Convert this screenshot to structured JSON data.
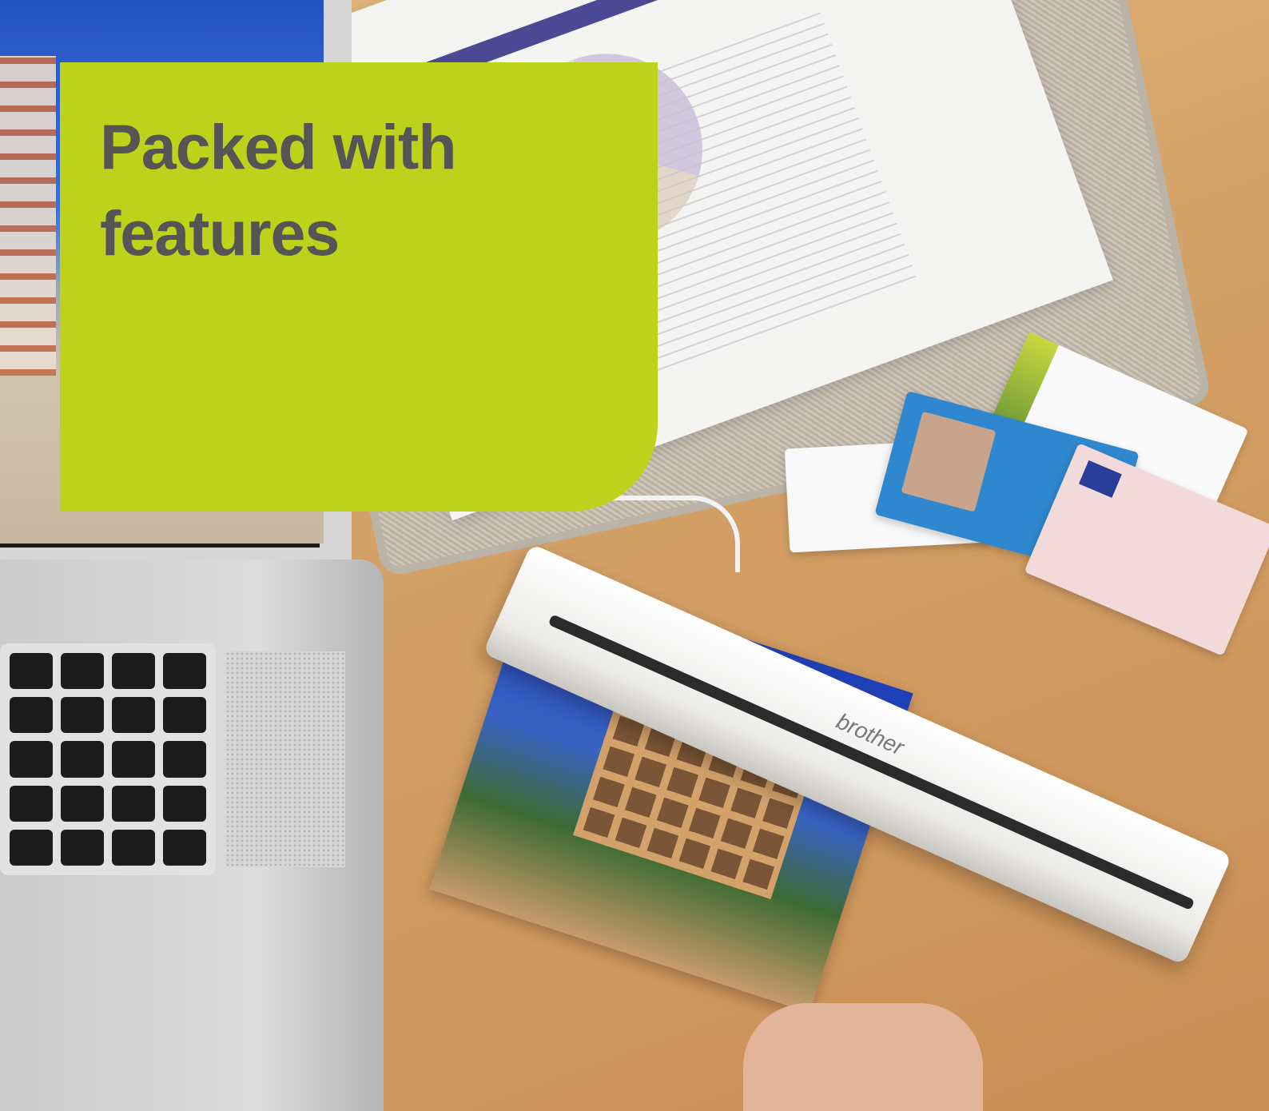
{
  "headline": {
    "line1": "Packed with",
    "line2": "features"
  },
  "colors": {
    "panel": "#bdd21a",
    "headline_text": "#555555"
  },
  "scanner": {
    "brand": "brother"
  }
}
